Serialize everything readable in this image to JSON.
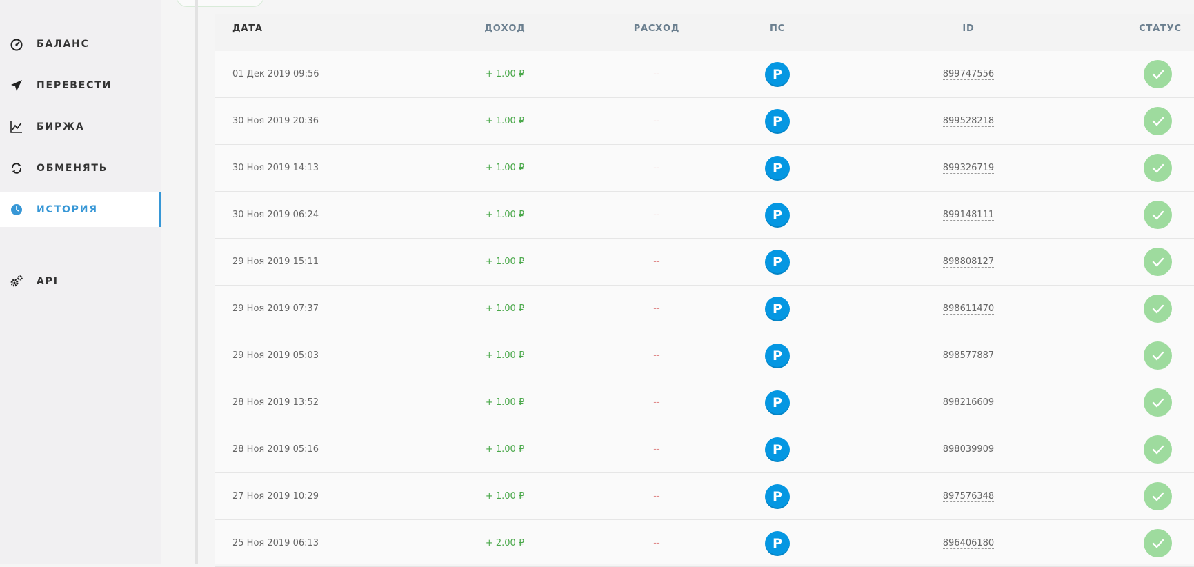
{
  "sidebar": {
    "items": [
      {
        "label": "БАЛАНС",
        "icon": "dashboard-gauge-icon"
      },
      {
        "label": "ПЕРЕВЕСТИ",
        "icon": "paper-plane-icon"
      },
      {
        "label": "БИРЖА",
        "icon": "line-chart-icon"
      },
      {
        "label": "ОБМЕНЯТЬ",
        "icon": "exchange-arrows-icon"
      },
      {
        "label": "ИСТОРИЯ",
        "icon": "clock-icon",
        "active": true
      },
      {
        "label": "API",
        "icon": "gears-icon"
      }
    ]
  },
  "table": {
    "headers": {
      "date": "ДАТА",
      "income": "ДОХОД",
      "expense": "РАСХОД",
      "ps": "ПС",
      "id": "ID",
      "status": "СТАТУС"
    },
    "ps_badge_letter": "P",
    "rows": [
      {
        "date": "01 Дек 2019 09:56",
        "income": "+ 1.00 ₽",
        "expense": "--",
        "id": "899747556"
      },
      {
        "date": "30 Ноя 2019 20:36",
        "income": "+ 1.00 ₽",
        "expense": "--",
        "id": "899528218"
      },
      {
        "date": "30 Ноя 2019 14:13",
        "income": "+ 1.00 ₽",
        "expense": "--",
        "id": "899326719"
      },
      {
        "date": "30 Ноя 2019 06:24",
        "income": "+ 1.00 ₽",
        "expense": "--",
        "id": "899148111"
      },
      {
        "date": "29 Ноя 2019 15:11",
        "income": "+ 1.00 ₽",
        "expense": "--",
        "id": "898808127"
      },
      {
        "date": "29 Ноя 2019 07:37",
        "income": "+ 1.00 ₽",
        "expense": "--",
        "id": "898611470"
      },
      {
        "date": "29 Ноя 2019 05:03",
        "income": "+ 1.00 ₽",
        "expense": "--",
        "id": "898577887"
      },
      {
        "date": "28 Ноя 2019 13:52",
        "income": "+ 1.00 ₽",
        "expense": "--",
        "id": "898216609"
      },
      {
        "date": "28 Ноя 2019 05:16",
        "income": "+ 1.00 ₽",
        "expense": "--",
        "id": "898039909"
      },
      {
        "date": "27 Ноя 2019 10:29",
        "income": "+ 1.00 ₽",
        "expense": "--",
        "id": "897576348"
      },
      {
        "date": "25 Ноя 2019 06:13",
        "income": "+ 2.00 ₽",
        "expense": "--",
        "id": "896406180"
      }
    ]
  },
  "colors": {
    "accent": "#3797d6",
    "income": "#4aa84a",
    "expense": "#e08a8a",
    "ps_badge": "#0597e2",
    "status_ok": "#9edb9e"
  }
}
